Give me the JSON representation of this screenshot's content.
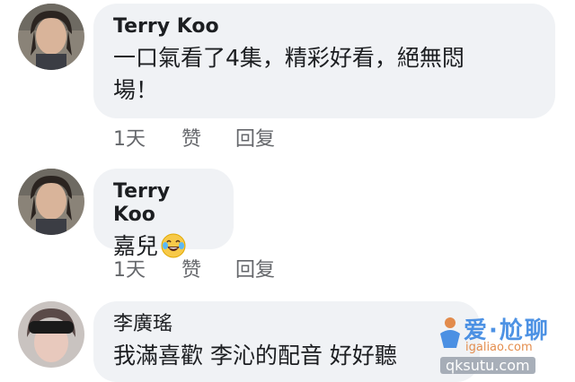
{
  "comments": [
    {
      "author": "Terry Koo",
      "text_line1": "一口氣看了4集，精彩好看，絕無悶",
      "text_line2": "場！",
      "time": "1天",
      "like": "赞",
      "reply": "回复"
    },
    {
      "author": "Terry Koo",
      "text": "嘉兒",
      "emoji_icon": "face-with-tears-of-joy",
      "time": "1天",
      "like": "赞",
      "reply": "回复"
    },
    {
      "author": "李廣瑤",
      "text": "我滿喜歡 李沁的配音 好好聽"
    }
  ],
  "watermark": {
    "title": "爱·尬聊",
    "site": "igaliao.com",
    "site2": "qksutu.com"
  }
}
